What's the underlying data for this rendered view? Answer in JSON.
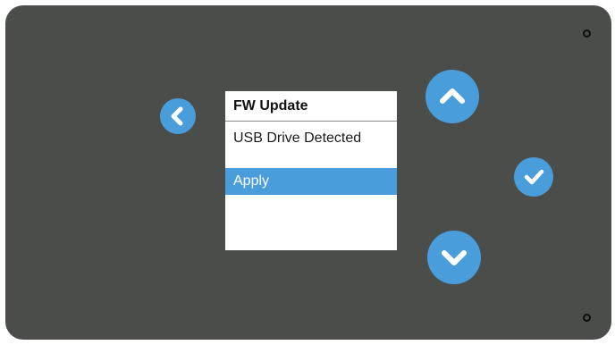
{
  "device": {
    "panel_color": "#4b4d4a",
    "accent_color": "#4a9ddb"
  },
  "screen": {
    "title": "FW Update",
    "status_text": "USB Drive Detected",
    "selected_item": "Apply"
  },
  "controls": {
    "back_icon": "chevron-left-icon",
    "up_icon": "chevron-up-icon",
    "down_icon": "chevron-down-icon",
    "confirm_icon": "checkmark-icon"
  }
}
